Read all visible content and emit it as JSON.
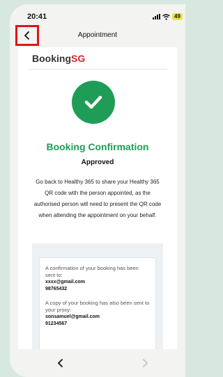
{
  "status_bar": {
    "time": "20:41",
    "battery": "49",
    "icons": [
      "signal-icon",
      "wifi-icon",
      "battery-icon"
    ]
  },
  "header": {
    "title": "Appointment",
    "back_icon": "chevron-left-icon",
    "highlight_color": "#e0141b"
  },
  "brand": {
    "logo_main": "Booking",
    "logo_accent": "SG",
    "accent_color": "#d8232a"
  },
  "confirmation": {
    "icon": "checkmark-icon",
    "title": "Booking Confirmation",
    "status": "Approved",
    "instructions": "Go back to Healthy 365 to share your Healthy 365 QR code with the person appointed, as the authorised person will need to present the QR code when attending the appointment on your behalf.",
    "color": "#1f9d57"
  },
  "details": {
    "sent_label": "A confirmation of your booking has been sent to:",
    "sent_email": "xxxx@gmail.com",
    "sent_phone": "98765432",
    "proxy_label": "A copy of your booking has also been sent to your proxy:",
    "proxy_email": "sonsamuel@gmail.com",
    "proxy_phone": "91234567"
  },
  "bottom_nav": {
    "back_icon": "chevron-left-icon",
    "forward_icon": "chevron-right-icon"
  }
}
